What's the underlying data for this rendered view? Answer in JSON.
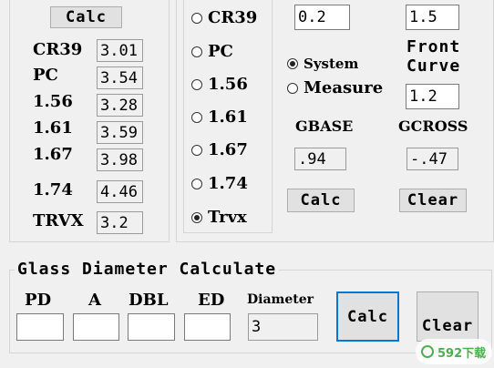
{
  "left_group": {
    "calc_label": "Calc",
    "rows": [
      {
        "label": "CR39",
        "value": "3.01"
      },
      {
        "label": "PC",
        "value": "3.54"
      },
      {
        "label": "1.56",
        "value": "3.28"
      },
      {
        "label": "1.61",
        "value": "3.59"
      },
      {
        "label": "1.67",
        "value": "3.98"
      },
      {
        "label": "1.74",
        "value": "4.46"
      },
      {
        "label": "TRVX",
        "value": "3.2"
      }
    ]
  },
  "material_radios": [
    {
      "label": "CR39",
      "checked": false
    },
    {
      "label": "PC",
      "checked": false
    },
    {
      "label": "1.56",
      "checked": false
    },
    {
      "label": "1.61",
      "checked": false
    },
    {
      "label": "1.67",
      "checked": false
    },
    {
      "label": "1.74",
      "checked": false
    },
    {
      "label": "Trvx",
      "checked": true
    }
  ],
  "right_group": {
    "field_top_left": "0.2",
    "field_top_right": "1.5",
    "front_curve_label_1": "Front",
    "front_curve_label_2": "Curve",
    "front_curve_value": "1.2",
    "mode_radios": [
      {
        "label": "System",
        "checked": true
      },
      {
        "label": "Measure",
        "checked": false
      }
    ],
    "gbase_label": "GBASE",
    "gbase_value": ".94",
    "gcross_label": "GCROSS",
    "gcross_value": "-.47",
    "calc_label": "Calc",
    "clear_label": "Clear"
  },
  "glass_diameter": {
    "title": "Glass Diameter Calculate",
    "pd_label": "PD",
    "pd_value": "",
    "a_label": "A",
    "a_value": "",
    "dbl_label": "DBL",
    "dbl_value": "",
    "ed_label": "ED",
    "ed_value": "",
    "diameter_label": "Diameter",
    "diameter_value": "3",
    "calc_label": "Calc",
    "clear_label": "Clear"
  },
  "watermark": "592下载"
}
